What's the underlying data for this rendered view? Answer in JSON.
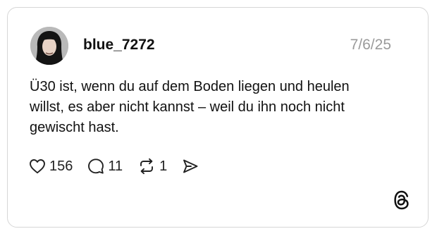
{
  "post": {
    "username": "blue_7272",
    "date": "7/6/25",
    "text_lines": [
      "Ü30 ist, wenn du auf dem Boden liegen und heulen",
      "willst, es aber nicht kannst – weil du ihn noch nicht",
      "gewischt hast."
    ]
  },
  "actions": {
    "likes": "156",
    "replies": "11",
    "reposts": "1"
  },
  "icons": {
    "like": "heart-icon",
    "reply": "speech-bubble-icon",
    "repost": "repost-arrows-icon",
    "share": "send-icon",
    "brand": "threads-logo-icon"
  }
}
